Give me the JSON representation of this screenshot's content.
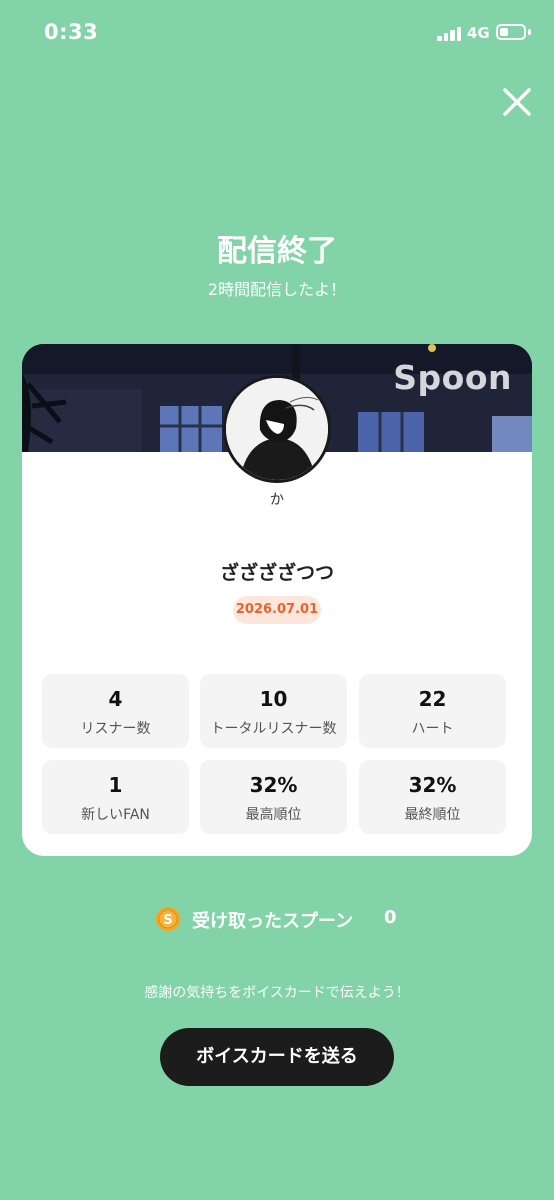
{
  "status_bar": {
    "time": "0:33",
    "network": "4G",
    "signal_bars": 4,
    "battery_level": 0.25
  },
  "header": {
    "close_icon": "close-icon",
    "title": "配信終了",
    "subtitle": "2時間配信したよ！"
  },
  "card": {
    "brand": "Spoon",
    "username": "か",
    "stream_title": "ざざざざつつ",
    "date": "2026.07.01",
    "stats": [
      {
        "value": "4",
        "label": "リスナー数"
      },
      {
        "value": "10",
        "label": "トータルリスナー数"
      },
      {
        "value": "22",
        "label": "ハート"
      },
      {
        "value": "1",
        "label": "新しいFAN"
      },
      {
        "value": "32%",
        "label": "最高順位"
      },
      {
        "value": "32%",
        "label": "最終順位"
      }
    ]
  },
  "spoons": {
    "icon": "spoon-coin-icon",
    "coin_letter": "S",
    "label": "受け取ったスプーン",
    "count": "0"
  },
  "footer": {
    "thanks_text": "感謝の気持ちをボイスカードで伝えよう！",
    "voice_card_button": "ボイスカードを送る"
  },
  "colors": {
    "background": "#82d3a7",
    "card": "#ffffff",
    "date_badge_bg": "#fde6dc",
    "date_badge_text": "#e8642e",
    "button": "#1c1c1c",
    "coin": "#f5a623"
  }
}
